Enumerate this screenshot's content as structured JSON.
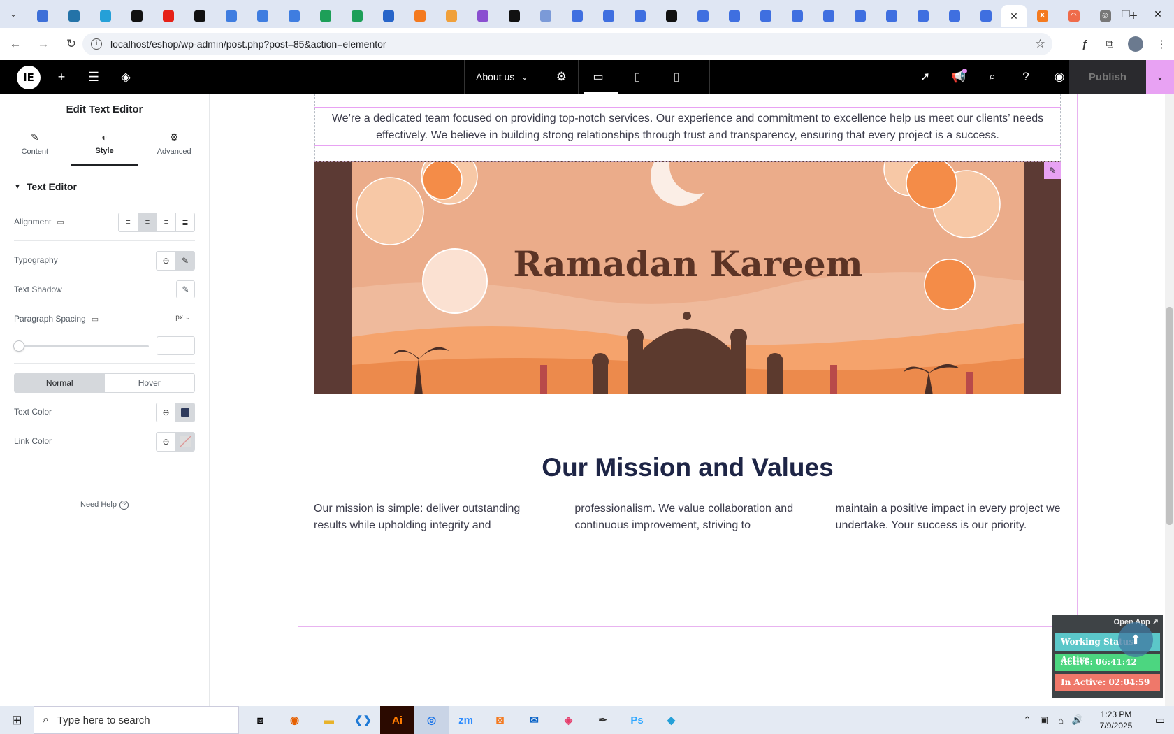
{
  "browser": {
    "url": "localhost/eshop/wp-admin/post.php?post=85&action=elementor",
    "tabs": [
      {
        "icon": "wp-icon",
        "color": "#3d6fd8"
      },
      {
        "icon": "wp-icon",
        "color": "#2473a8"
      },
      {
        "icon": "puzzle-icon",
        "color": "#25a0d8"
      },
      {
        "icon": "github-icon",
        "color": "#111111"
      },
      {
        "icon": "youtube-icon",
        "color": "#e62117"
      },
      {
        "icon": "bolt-icon",
        "color": "#111111"
      },
      {
        "icon": "docs-icon",
        "color": "#3f7de0"
      },
      {
        "icon": "docs-icon",
        "color": "#3f7de0"
      },
      {
        "icon": "docs-icon",
        "color": "#3f7de0"
      },
      {
        "icon": "sheets-icon",
        "color": "#1d9f58"
      },
      {
        "icon": "sheets-icon",
        "color": "#1d9f58"
      },
      {
        "icon": "ms-icon",
        "color": "#2765c9"
      },
      {
        "icon": "xampp-icon",
        "color": "#f47a1f"
      },
      {
        "icon": "vue-icon",
        "color": "#f0a03a"
      },
      {
        "icon": "brackets-icon",
        "color": "#8a4fd0"
      },
      {
        "icon": "code-icon",
        "color": "#111111"
      },
      {
        "icon": "grid-icon",
        "color": "#7b9ad8"
      },
      {
        "icon": "forms-icon",
        "color": "#3f6fe0"
      },
      {
        "icon": "forms-icon",
        "color": "#3f6fe0"
      },
      {
        "icon": "forms-icon",
        "color": "#3f6fe0"
      },
      {
        "icon": "m-icon",
        "color": "#111111"
      },
      {
        "icon": "forms-icon",
        "color": "#3f6fe0"
      },
      {
        "icon": "forms-icon",
        "color": "#3f6fe0"
      },
      {
        "icon": "forms-icon",
        "color": "#3f6fe0"
      },
      {
        "icon": "forms-icon",
        "color": "#3f6fe0"
      },
      {
        "icon": "forms-icon",
        "color": "#3f6fe0"
      },
      {
        "icon": "forms-icon",
        "color": "#3f6fe0"
      },
      {
        "icon": "forms-icon",
        "color": "#3f6fe0"
      },
      {
        "icon": "forms-icon",
        "color": "#3f6fe0"
      },
      {
        "icon": "forms-icon",
        "color": "#3f6fe0"
      },
      {
        "icon": "forms-icon",
        "color": "#3f6fe0"
      }
    ]
  },
  "elementor": {
    "page_name": "About us",
    "publish_label": "Publish",
    "panel": {
      "title": "Edit Text Editor",
      "tabs": {
        "content": "Content",
        "style": "Style",
        "advanced": "Advanced"
      },
      "section": "Text Editor",
      "alignment_label": "Alignment",
      "typography_label": "Typography",
      "text_shadow_label": "Text Shadow",
      "paragraph_spacing_label": "Paragraph Spacing",
      "unit": "px",
      "state_normal": "Normal",
      "state_hover": "Hover",
      "text_color_label": "Text Color",
      "link_color_label": "Link Color",
      "need_help": "Need Help",
      "text_color_value": "#2e3a5c"
    }
  },
  "page": {
    "intro": "We’re a dedicated team focused on providing top-notch services. Our experience and commitment to excellence help us meet our clients’ needs effectively. We believe in building strong relationships through trust and transparency, ensuring that every project is a success.",
    "banner_title": "Ramadan Kareem",
    "mission_heading": "Our Mission and Values",
    "columns": [
      "Our mission is simple: deliver outstanding results while upholding integrity and",
      "professionalism. We value collaboration and continuous improvement, striving to",
      "maintain a positive impact in every project we undertake. Your success is our priority."
    ]
  },
  "widget": {
    "open_app": "Open App ↗",
    "status": "Working Status: Active",
    "active": "Active: 06:41:42",
    "inactive": "In Active: 02:04:59"
  },
  "taskbar": {
    "search_placeholder": "Type here to search",
    "time": "1:23 PM",
    "date": "7/9/2025"
  }
}
